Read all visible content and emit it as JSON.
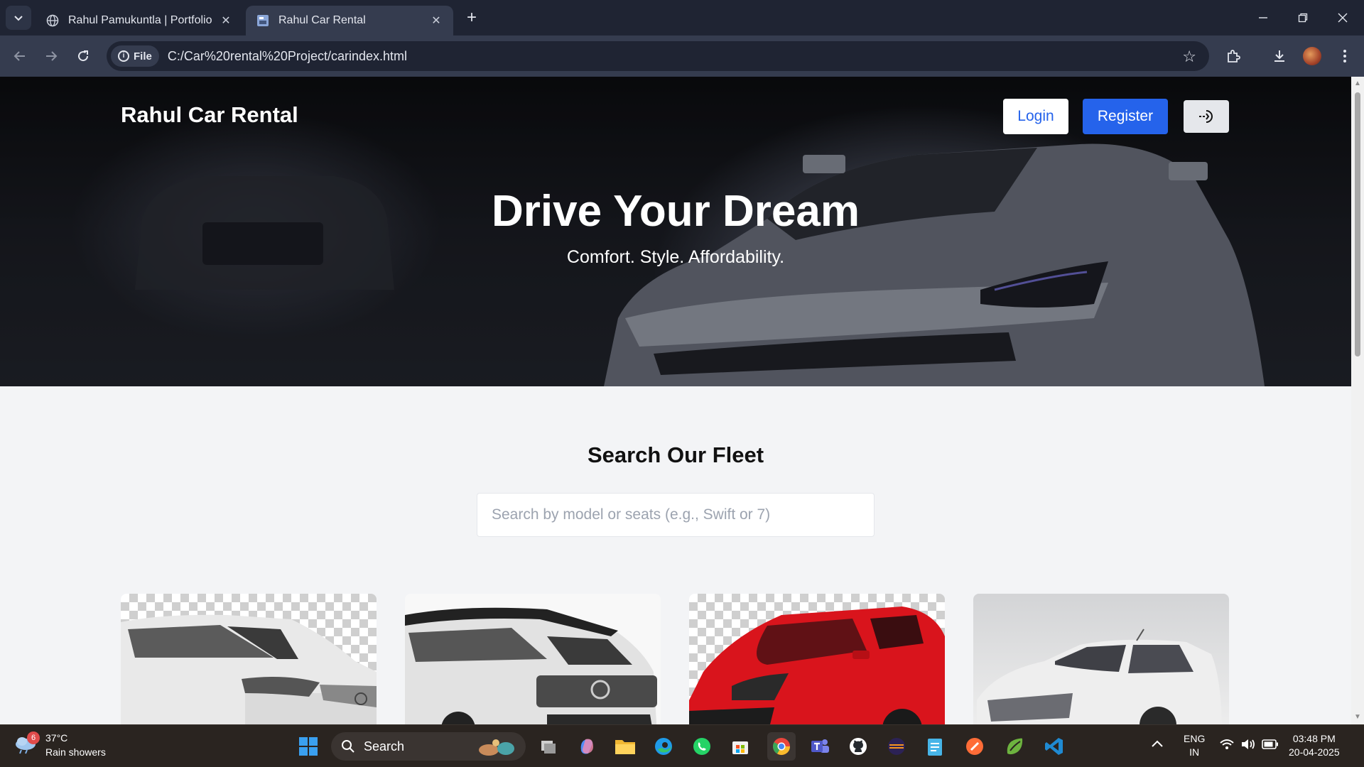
{
  "browser": {
    "tabs": [
      {
        "title": "Rahul Pamukuntla | Portfolio",
        "favicon": "globe-icon",
        "active": false
      },
      {
        "title": "Rahul Car Rental",
        "favicon": "page-icon",
        "active": true
      }
    ],
    "address": {
      "scheme_label": "File",
      "url": "C:/Car%20rental%20Project/carindex.html"
    },
    "new_tab_label": "+"
  },
  "site": {
    "brand": "Rahul Car Rental",
    "nav": {
      "login_label": "Login",
      "register_label": "Register",
      "theme_toggle_icon": "theme-toggle-icon"
    },
    "hero": {
      "title": "Drive Your Dream",
      "subtitle": "Comfort. Style. Affordability."
    },
    "fleet": {
      "title": "Search Our Fleet",
      "search_placeholder": "Search by model or seats (e.g., Swift or 7)",
      "cards": [
        {
          "car": "white-mpv",
          "color": "#e9e9e9"
        },
        {
          "car": "white-suv",
          "color": "#e2e2e2"
        },
        {
          "car": "red-hatchback",
          "color": "#d9141c"
        },
        {
          "car": "white-mpv-2",
          "color": "#eeeeee"
        }
      ]
    },
    "accent_color": "#2563eb"
  },
  "taskbar": {
    "weather": {
      "temp": "37°C",
      "condition": "Rain showers",
      "badge": "6"
    },
    "search_label": "Search",
    "apps": [
      "task-view-icon",
      "copilot-icon",
      "file-explorer-icon",
      "edge-icon",
      "whatsapp-icon",
      "store-icon",
      "chrome-icon",
      "teams-icon",
      "github-icon",
      "eclipse-icon",
      "notepad-icon",
      "postman-icon",
      "spring-icon",
      "vscode-icon"
    ],
    "tray": {
      "lang_top": "ENG",
      "lang_bottom": "IN",
      "time": "03:48 PM",
      "date": "20-04-2025"
    }
  }
}
